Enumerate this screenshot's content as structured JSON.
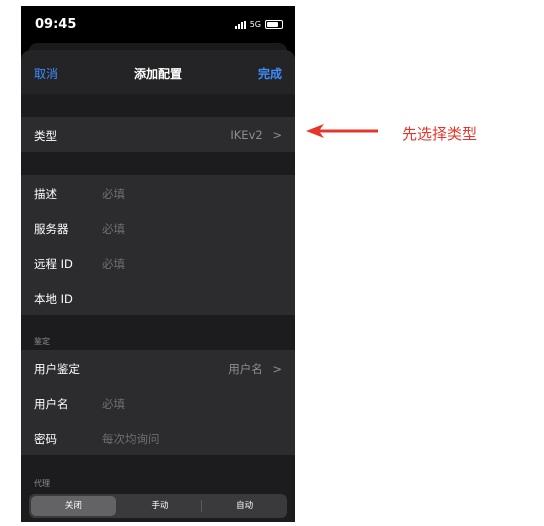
{
  "status_bar": {
    "time": "09:45",
    "network": "5G"
  },
  "nav": {
    "cancel": "取消",
    "title": "添加配置",
    "done": "完成"
  },
  "type_row": {
    "label": "类型",
    "value": "IKEv2",
    "chevron": ">"
  },
  "fields": [
    {
      "label": "描述",
      "placeholder": "必填"
    },
    {
      "label": "服务器",
      "placeholder": "必填"
    },
    {
      "label": "远程 ID",
      "placeholder": "必填"
    },
    {
      "label": "本地 ID",
      "placeholder": ""
    }
  ],
  "auth": {
    "header": "鉴定",
    "user_auth": {
      "label": "用户鉴定",
      "value": "用户名",
      "chevron": ">"
    },
    "username": {
      "label": "用户名",
      "placeholder": "必填"
    },
    "password": {
      "label": "密码",
      "placeholder": "每次均询问"
    }
  },
  "proxy": {
    "header": "代理",
    "options": [
      "关闭",
      "手动",
      "自动"
    ],
    "selected": "关闭"
  },
  "annotation": {
    "text": "先选择类型",
    "color": "#e6362b"
  },
  "colors": {
    "accent": "#3d8dff",
    "row_bg": "#2c2c2e",
    "sheet_bg": "#1c1c1e"
  }
}
